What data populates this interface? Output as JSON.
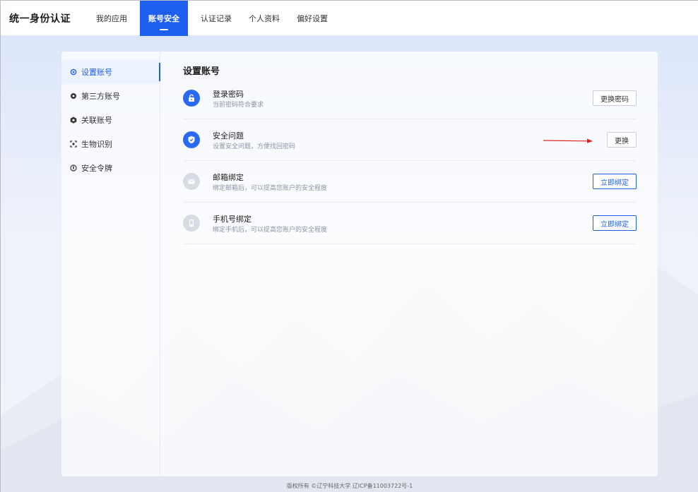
{
  "header": {
    "brand": "统一身份认证",
    "tabs": [
      {
        "label": "我的应用",
        "active": false
      },
      {
        "label": "账号安全",
        "active": true
      },
      {
        "label": "认证记录",
        "active": false
      },
      {
        "label": "个人资料",
        "active": false
      },
      {
        "label": "偏好设置",
        "active": false
      }
    ]
  },
  "sidebar": {
    "items": [
      {
        "label": "设置账号",
        "icon": "gear-icon",
        "active": true
      },
      {
        "label": "第三方账号",
        "icon": "third-party-icon",
        "active": false
      },
      {
        "label": "关联账号",
        "icon": "link-account-icon",
        "active": false
      },
      {
        "label": "生物识别",
        "icon": "biometric-icon",
        "active": false
      },
      {
        "label": "安全令牌",
        "icon": "token-icon",
        "active": false
      }
    ]
  },
  "main": {
    "title": "设置账号",
    "rows": [
      {
        "title": "登录密码",
        "desc": "当前密码符合要求",
        "button": "更换密码",
        "icon": "lock-icon",
        "button_style": "default"
      },
      {
        "title": "安全问题",
        "desc": "设置安全问题，方便找回密码",
        "button": "更换",
        "icon": "shield-icon",
        "button_style": "default"
      },
      {
        "title": "邮箱绑定",
        "desc": "绑定邮箱后，可以提高您账户的安全程度",
        "button": "立即绑定",
        "icon": "mail-icon",
        "button_style": "primary"
      },
      {
        "title": "手机号绑定",
        "desc": "绑定手机后，可以提高您账户的安全程度",
        "button": "立即绑定",
        "icon": "phone-icon",
        "button_style": "primary"
      }
    ]
  },
  "footer": {
    "text": "版权所有 ©辽宁科技大学 辽ICP备11003722号-1"
  },
  "colors": {
    "accent": "#1f5ff0",
    "annotation_arrow": "#e02020"
  }
}
